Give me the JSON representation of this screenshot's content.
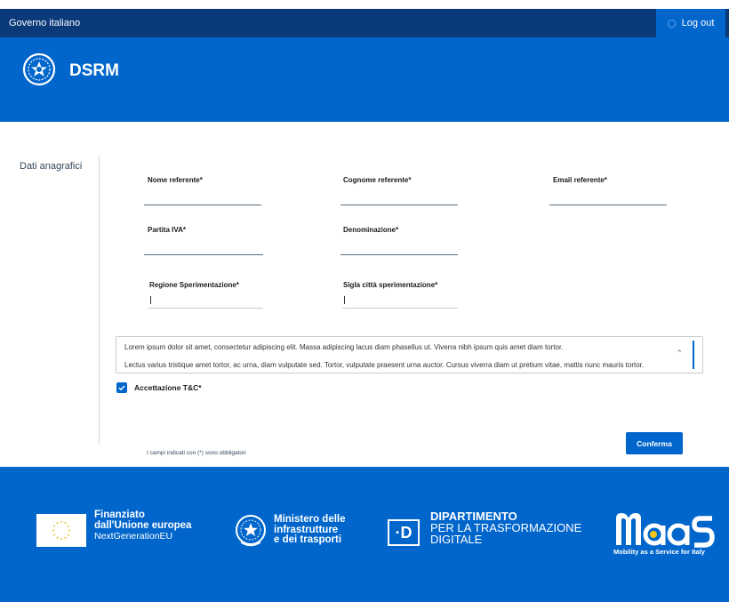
{
  "topbar": {
    "gov_label": "Governo italiano",
    "logout_label": "Log out",
    "logout_icon": "user-icon"
  },
  "header": {
    "brand": "DSRM",
    "emblem_icon": "emblem-icon"
  },
  "sidebar": {
    "items": [
      {
        "label": "Dati anagrafici"
      }
    ]
  },
  "form": {
    "fields": {
      "nome": {
        "label": "Nome referente*",
        "value": ""
      },
      "cognome": {
        "label": "Cognome referente*",
        "value": ""
      },
      "email": {
        "label": "Email referente*",
        "value": ""
      },
      "partita_iva": {
        "label": "Partita IVA*",
        "value": ""
      },
      "denominazione": {
        "label": "Denominazione*",
        "value": ""
      },
      "regione": {
        "label": "Regione Sperimentazione*",
        "value": ""
      },
      "sigla": {
        "label": "Sigla città sperimentazione*",
        "value": ""
      }
    },
    "terms_text": {
      "p1": "Lorem ipsum dolor sit amet, consectetur adipiscing elit. Massa adipiscing lacus diam phasellus ut. Viverra nibh ipsum quis amet diam tortor.",
      "p2": "Lectus varius tristique amet tortor, ac urna, diam vulputate sed. Tortor, vulputate praesent urna auctor. Cursus viverra diam ut pretium vitae, mattis nunc mauris tortor."
    },
    "accept_label": "Accettazione T&C*",
    "accept_checked": true,
    "note": "I campi indicati con (*) sono obbligatori",
    "submit_label": "Conferma"
  },
  "footer": {
    "eu": {
      "line1": "Finanziato",
      "line2": "dall'Unione europea",
      "line3": "NextGenerationEU"
    },
    "ministero": {
      "line1": "Ministero delle",
      "line2": "infrastrutture",
      "line3": "e dei trasporti"
    },
    "dipartimento": {
      "box": "·D",
      "line1": "DIPARTIMENTO",
      "line2": "PER LA TRASFORMAZIONE",
      "line3": "DIGITALE"
    },
    "maas": {
      "logo": "MaaS",
      "tagline_a": "Mobility as a Service ",
      "tagline_b": "for Italy"
    }
  },
  "colors": {
    "primary": "#0066cc",
    "topbar": "#0a3a7a"
  }
}
